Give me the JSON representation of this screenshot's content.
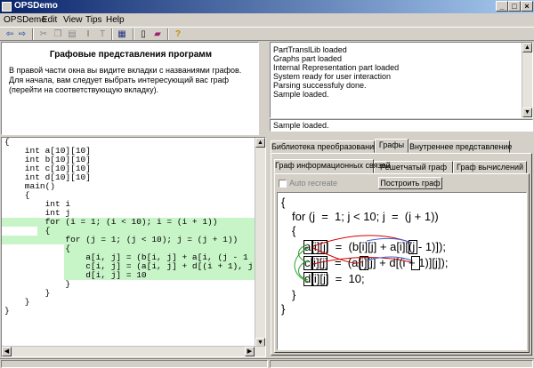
{
  "window": {
    "title": "OPSDemo",
    "buttons": [
      "_",
      "□",
      "×"
    ]
  },
  "menu": [
    "OPSDemo",
    "Edit",
    "View",
    "Tips",
    "Help"
  ],
  "description": {
    "title": "Графовые представления программ",
    "text": "В правой части окна вы видите вкладки с названиями графов. Для начала, вам следует выбрать интересующий вас граф (перейти на соответствующую вкладку)."
  },
  "log": {
    "lines": [
      "PartTranslLib loaded",
      "Graphs part loaded",
      "Internal Representation part loaded",
      "System ready for user interaction",
      "Parsing successfuly done.",
      "Sample loaded."
    ],
    "status": "Sample loaded."
  },
  "code": {
    "lines": [
      "{",
      "    int a[10][10]",
      "    int b[10][10]",
      "    int c[10][10]",
      "    int d[10][10]",
      "    main()",
      "    {",
      "        int i",
      "        int j",
      "        for (i = 1; (i < 10); i = (i + 1))",
      "        {",
      "            for (j = 1; (j < 10); j = (j + 1))",
      "            {",
      "                a[i, j] = (b[i, j] + a[i, (j - 1",
      "                c[i, j] = (a[i, j] + d[(i + 1), j",
      "                d[i, j] = 10",
      "            }",
      "        }",
      "    }",
      "}"
    ]
  },
  "tabs_main": [
    "Библиотека преобразований",
    "Графы",
    "Внутреннее представление"
  ],
  "tabs_graph": [
    "Граф информационных связей",
    "Решетчатый граф",
    "Граф вычислений"
  ],
  "auto_recreate": "Auto recreate",
  "build_button": "Построить граф",
  "graph": {
    "lines": [
      "{",
      "for (j  =  1; j < 10; j  =  (j + 1))",
      "{",
      "a[i][j]  =  (b[i][j] + a[i][(j - 1)]);",
      "c[i][j]  =  (a[i][j] + d[(i + 1)][j]);",
      "d[i][j]  =  10;",
      "}",
      "}"
    ]
  },
  "colors": {
    "highlight": "#c8f5c8",
    "arc_red": "#d00000",
    "arc_blue": "#4060d0",
    "arc_green": "#30a030",
    "title_bg": "#0a246a"
  }
}
